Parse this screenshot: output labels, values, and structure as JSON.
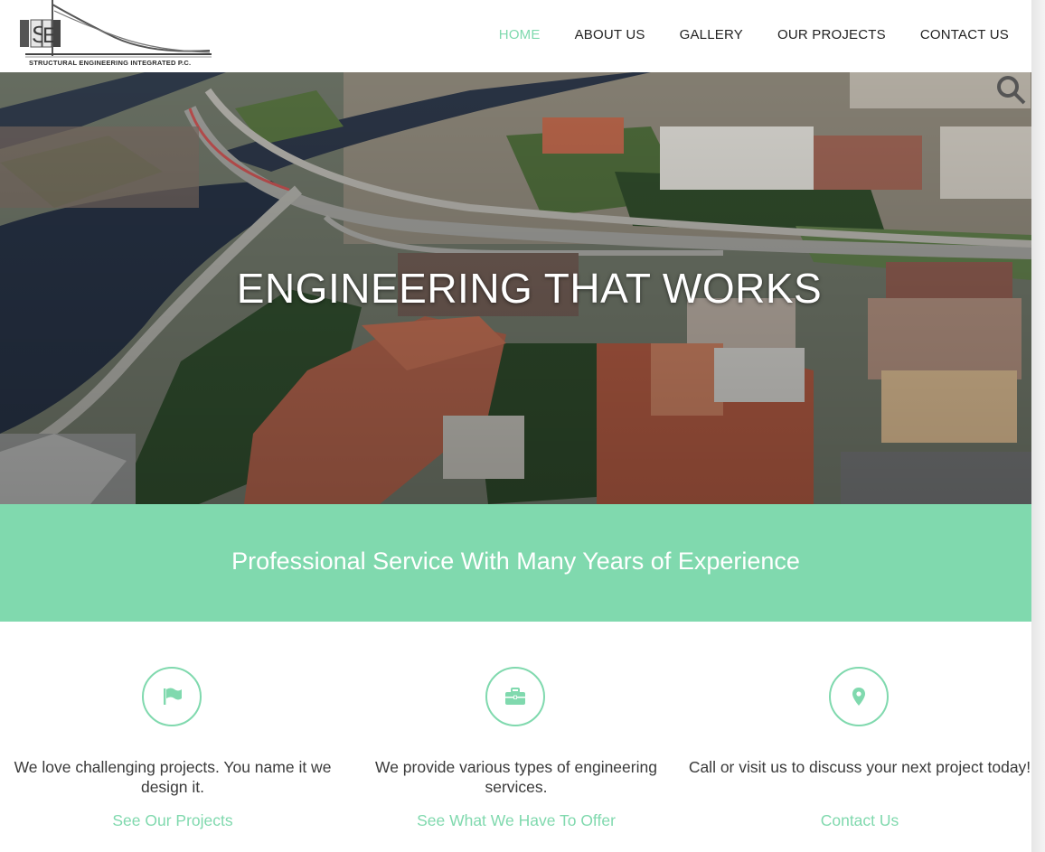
{
  "brand": {
    "logo_letters": "SEI",
    "name": "STRUCTURAL ENGINEERING INTEGRATED P.C."
  },
  "nav": {
    "items": [
      "HOME",
      "ABOUT US",
      "GALLERY",
      "OUR PROJECTS",
      "CONTACT US"
    ],
    "active": "HOME"
  },
  "hero": {
    "title": "ENGINEERING THAT WORKS"
  },
  "band": {
    "text": "Professional Service With Many Years of Experience"
  },
  "features": [
    {
      "icon": "flag-icon",
      "text": "We love challenging projects. You name it we design it.",
      "link": "See Our Projects"
    },
    {
      "icon": "briefcase-icon",
      "text": "We provide various types of engineering services.",
      "link": "See What We Have To Offer"
    },
    {
      "icon": "map-marker-icon",
      "text": "Call or visit us to discuss your next project today!",
      "link": "Contact Us"
    }
  ],
  "colors": {
    "accent": "#80d9ae",
    "text": "#3a3a3a",
    "nav_text": "#222222"
  }
}
